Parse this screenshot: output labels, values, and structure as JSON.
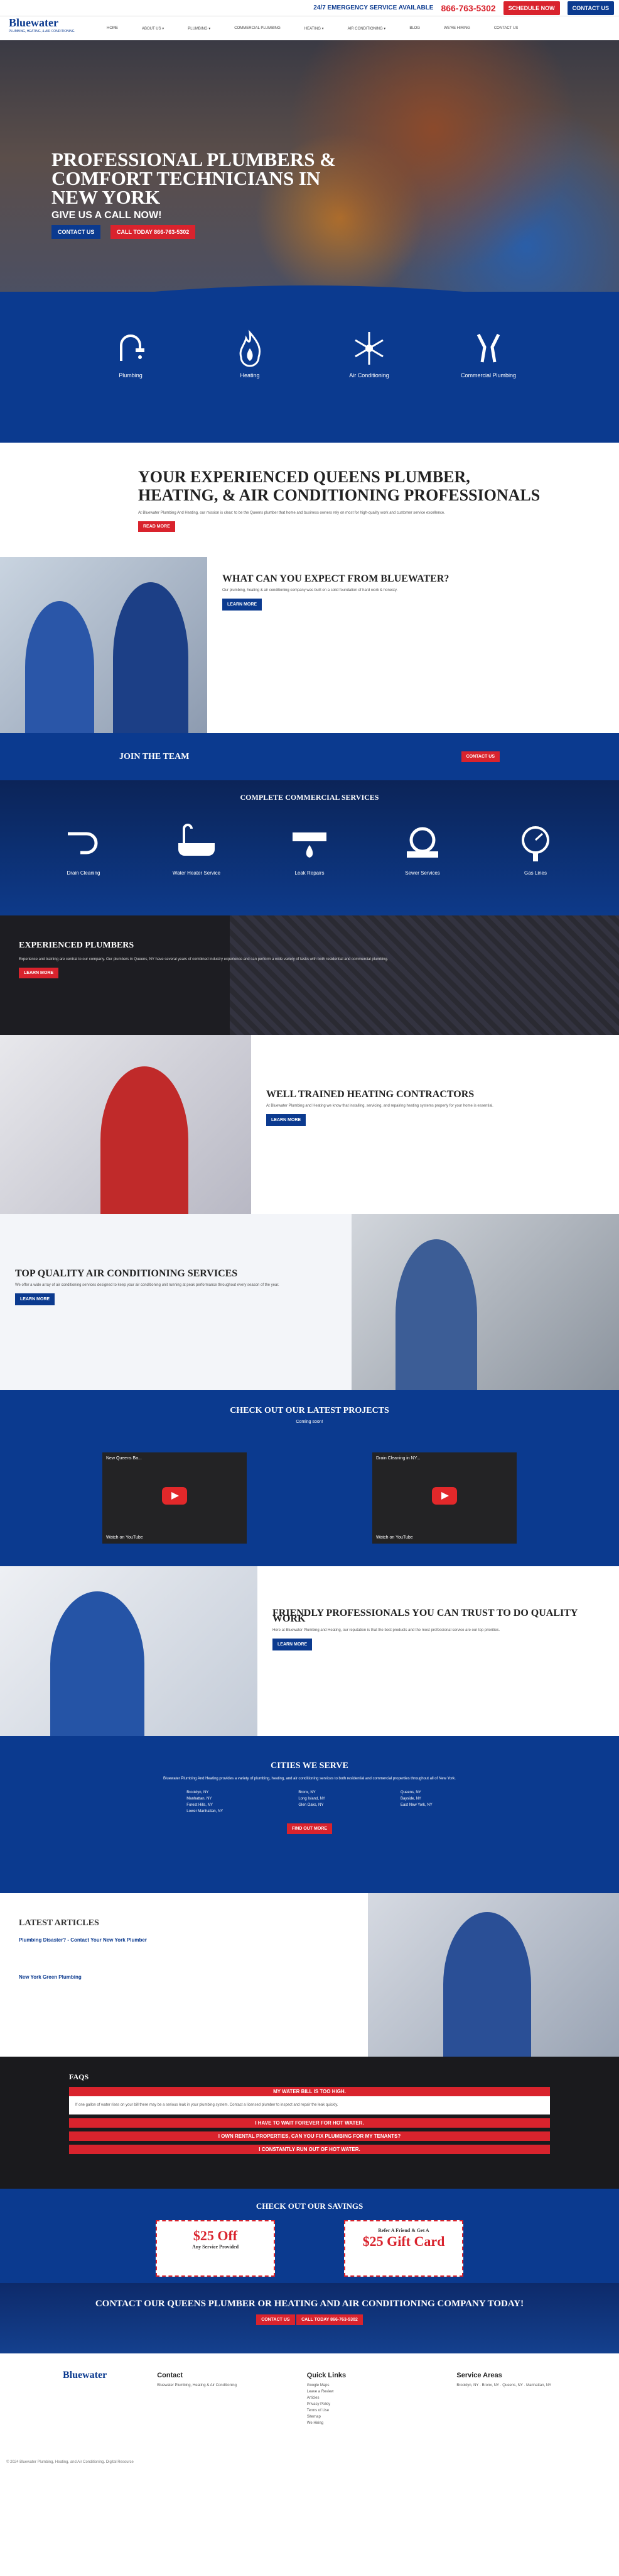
{
  "brand": {
    "name": "Bluewater",
    "tagline": "PLUMBING, HEATING, & AIR CONDITIONING"
  },
  "topbar": {
    "emergency": "24/7 EMERGENCY SERVICE AVAILABLE",
    "phone": "866-763-5302",
    "schedule": "SCHEDULE NOW",
    "contact": "CONTACT US"
  },
  "nav": [
    "HOME",
    "ABOUT US ▾",
    "PLUMBING ▾",
    "COMMERCIAL PLUMBING",
    "HEATING ▾",
    "AIR CONDITIONING ▾",
    "BLOG",
    "WE'RE HIRING",
    "CONTACT US"
  ],
  "hero": {
    "title": "PROFESSIONAL PLUMBERS & COMFORT TECHNICIANS IN NEW YORK",
    "sub": "GIVE US A CALL NOW!",
    "btn1": "CONTACT US",
    "btn2": "CALL TODAY 866-763-5302"
  },
  "services": [
    {
      "label": "Plumbing",
      "icon": "faucet-icon"
    },
    {
      "label": "Heating",
      "icon": "flame-icon"
    },
    {
      "label": "Air Conditioning",
      "icon": "snowflake-icon"
    },
    {
      "label": "Commercial Plumbing",
      "icon": "wrench-icon"
    }
  ],
  "about": {
    "title": "YOUR EXPERIENCED QUEENS PLUMBER, HEATING, & AIR CONDITIONING PROFESSIONALS",
    "body": "At Bluewater Plumbing And Heating, our mission is clear: to be the Queens plumber that home and business owners rely on most for high-quality work and customer service excellence.",
    "btn": "READ MORE"
  },
  "expect": {
    "title": "WHAT CAN YOU EXPECT FROM BLUEWATER?",
    "body": "Our plumbing, heating & air conditioning company was built on a solid foundation of hard work & honesty.",
    "btn": "LEARN MORE"
  },
  "join": {
    "label": "JOIN THE TEAM",
    "btn": "CONTACT US"
  },
  "commercial": {
    "title": "COMPLETE COMMERCIAL SERVICES",
    "items": [
      "Drain Cleaning",
      "Water Heater Service",
      "Leak Repairs",
      "Sewer Services",
      "Gas Lines"
    ]
  },
  "experienced": {
    "title": "EXPERIENCED PLUMBERS",
    "body": "Experience and training are central to our company. Our plumbers in Queens, NY have several years of combined industry experience and can perform a wide variety of tasks with both residential and commercial plumbing.",
    "btn": "LEARN MORE"
  },
  "trained": {
    "title": "WELL TRAINED HEATING CONTRACTORS",
    "body": "At Bluewater Plumbing and Heating we know that installing, servicing, and repairing heating systems properly for your home is essential.",
    "btn": "LEARN MORE"
  },
  "ac": {
    "title": "TOP QUALITY AIR CONDITIONING SERVICES",
    "body": "We offer a wide array of air conditioning services designed to keep your air conditioning unit running at peak performance throughout every season of the year.",
    "btn": "LEARN MORE"
  },
  "projects": {
    "title": "CHECK OUT OUR LATEST PROJECTS",
    "sub": "Coming soon!",
    "videos": [
      "New Queens Ba...",
      "Drain Cleaning in NY..."
    ],
    "watch": "Watch on YouTube"
  },
  "friendly": {
    "title": "FRIENDLY PROFESSIONALS YOU CAN TRUST TO DO QUALITY WORK",
    "body": "Here at Bluewater Plumbing and Heating, our reputation is that the best products and the most professional service are our top priorities.",
    "btn": "LEARN MORE"
  },
  "cities": {
    "title": "CITIES WE SERVE",
    "body": "Bluewater Plumbing And Heating provides a variety of plumbing, heating, and air conditioning services to both residential and commercial properties throughout all of New York.",
    "col1": [
      "Brooklyn, NY",
      "Manhattan, NY",
      "Forest Hills, NY",
      "Lower Manhattan, NY"
    ],
    "col2": [
      "Bronx, NY",
      "Long Island, NY",
      "Glen Oaks, NY"
    ],
    "col3": [
      "Queens, NY",
      "Bayside, NY",
      "East New York, NY"
    ],
    "btn": "FIND OUT MORE"
  },
  "articles": {
    "title": "LATEST ARTICLES",
    "items": [
      "Plumbing Disaster? - Contact Your New York Plumber",
      "New York Green Plumbing"
    ]
  },
  "faq": {
    "title": "FAQS",
    "q1": "MY WATER BILL IS TOO HIGH.",
    "a1": "If one gallon of water rises on your bill there may be a serious leak in your plumbing system. Contact a licensed plumber to inspect and repair the leak quickly.",
    "q2": "I HAVE TO WAIT FOREVER FOR HOT WATER.",
    "q3": "I OWN RENTAL PROPERTIES, CAN YOU FIX PLUMBING FOR MY TENANTS?",
    "q4": "I CONSTANTLY RUN OUT OF HOT WATER."
  },
  "savings": {
    "title": "CHECK OUT OUR SAVINGS",
    "c1": "$25 Off",
    "c1sub": "Any Service Provided",
    "c2": "$25 Gift Card",
    "c2sub": "Refer A Friend & Get A"
  },
  "cta": {
    "title": "CONTACT OUR QUEENS PLUMBER OR HEATING AND AIR CONDITIONING COMPANY TODAY!",
    "btn1": "CONTACT US",
    "btn2": "CALL TODAY 866-763-5302"
  },
  "footer": {
    "contact_title": "Contact",
    "contact": "Bluewater Plumbing, Heating & Air Conditioning",
    "quick_title": "Quick Links",
    "links": [
      "Google Maps",
      "Leave a Review",
      "Articles",
      "Privacy Policy",
      "Terms of Use",
      "Sitemap",
      "We Hiring"
    ],
    "areas_title": "Service Areas",
    "areas": "Brooklyn, NY · Bronx, NY · Queens, NY · Manhattan, NY",
    "copy": "© 2024 Bluewater Plumbing, Heating, and Air Conditioning. Digital Resource"
  }
}
